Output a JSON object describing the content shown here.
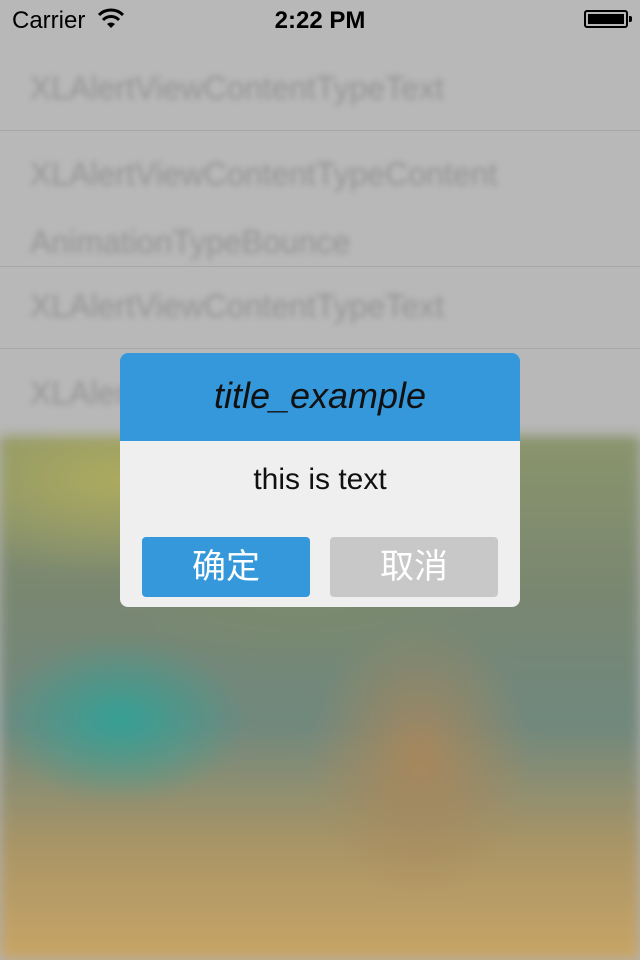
{
  "status_bar": {
    "carrier": "Carrier",
    "time": "2:22 PM",
    "wifi_icon": "wifi-icon",
    "battery_icon": "battery-icon"
  },
  "background_list": {
    "items": [
      "XLAlertViewContentTypeText",
      "XLAlertViewContentTypeContent",
      "AnimationTypeBounce",
      "XLAlertViewContentTypeText",
      "XLAlertViewContentTypeContent"
    ]
  },
  "alert": {
    "title": "title_example",
    "message": "this is text",
    "confirm_label": "确定",
    "cancel_label": "取消",
    "colors": {
      "accent": "#3598db",
      "body": "#efefef",
      "cancel": "#c8c8c8"
    }
  }
}
